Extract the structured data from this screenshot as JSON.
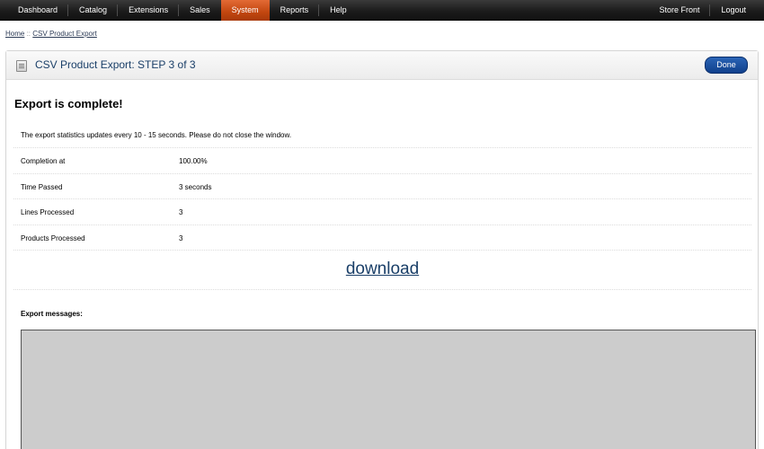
{
  "topnav": {
    "left": [
      "Dashboard",
      "Catalog",
      "Extensions",
      "Sales",
      "System",
      "Reports",
      "Help"
    ],
    "active": "System",
    "right": [
      "Store Front",
      "Logout"
    ]
  },
  "breadcrumb": {
    "home": "Home",
    "separator": "::",
    "current": "CSV Product Export"
  },
  "panel": {
    "title": "CSV Product Export: STEP 3 of 3",
    "done_label": "Done",
    "heading": "Export is complete!",
    "info": "The export statistics updates every 10 - 15 seconds. Please do not close the window.",
    "stats": [
      {
        "label": "Completion at",
        "value": "100.00%"
      },
      {
        "label": "Time Passed",
        "value": "3 seconds"
      },
      {
        "label": "Lines Processed",
        "value": "3"
      },
      {
        "label": "Products Processed",
        "value": "3"
      }
    ],
    "download_label": "download",
    "messages_label": "Export messages:"
  },
  "colors": {
    "nav_active": "#c2460f",
    "title": "#1a3f68",
    "done_button": "#10408c",
    "messages_bg": "#cccccc"
  }
}
